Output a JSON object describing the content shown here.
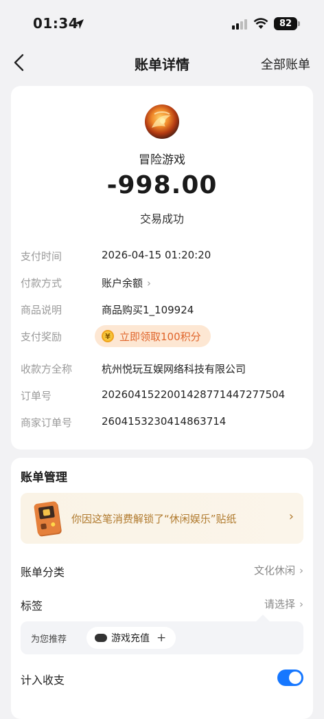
{
  "status_bar": {
    "time": "01:34",
    "battery": "82"
  },
  "nav": {
    "title": "账单详情",
    "right_link": "全部账单"
  },
  "summary": {
    "merchant": "冒险游戏",
    "amount": "-998.00",
    "status": "交易成功"
  },
  "details": [
    {
      "label": "支付时间",
      "value": "2026-04-15 01:20:20"
    },
    {
      "label": "付款方式",
      "value": "账户余额"
    },
    {
      "label": "商品说明",
      "value": "商品购买1_109924"
    },
    {
      "label": "支付奖励",
      "value": "立即领取100积分"
    },
    {
      "label": "收款方全称",
      "value": "杭州悦玩互娱网络科技有限公司"
    },
    {
      "label": "订单号",
      "value": "2026041522001428771447277504"
    },
    {
      "label": "商家订单号",
      "value": "2604153230414863714"
    }
  ],
  "management": {
    "title": "账单管理",
    "banner_text": "你因这笔消费解锁了“休闲娱乐”贴纸",
    "category": {
      "label": "账单分类",
      "value": "文化休闲"
    },
    "tags": {
      "label": "标签",
      "value": "请选择"
    },
    "recommend": {
      "label": "为您推荐",
      "chip": "游戏充值"
    },
    "count_in": {
      "label": "计入收支",
      "enabled": true
    }
  },
  "icons": [
    "back-arrow-icon",
    "location-arrow-icon",
    "signal-icon",
    "wifi-icon",
    "battery-icon",
    "coin-icon",
    "gameboy-icon",
    "gamepad-icon",
    "plus-icon",
    "chevron-right-icon"
  ],
  "colors": {
    "accent": "#1677ff",
    "reward": "#e0642a",
    "banner_text": "#b07a2e"
  }
}
